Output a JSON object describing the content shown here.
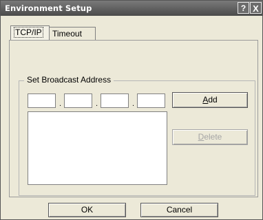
{
  "window": {
    "title": "Environment Setup",
    "help_glyph": "?",
    "close_glyph": "X"
  },
  "tabs": [
    {
      "label": "TCP/IP",
      "active": true
    },
    {
      "label": "Timeout",
      "active": false
    }
  ],
  "group": {
    "label": "Set Broadcast Address",
    "ip_octets": [
      "",
      "",
      "",
      ""
    ],
    "separator": ".",
    "list_items": []
  },
  "buttons": {
    "add": {
      "accel": "A",
      "rest": "dd"
    },
    "delete": {
      "accel": "D",
      "rest": "elete",
      "enabled": false
    },
    "ok": "OK",
    "cancel": "Cancel"
  }
}
